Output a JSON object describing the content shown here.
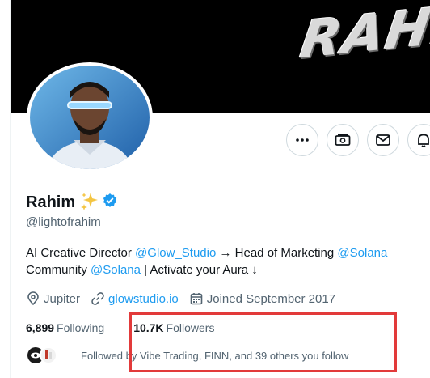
{
  "banner": {
    "text": "RAHI"
  },
  "profile": {
    "name": "Rahim",
    "name_emoji": "✨",
    "handle": "@lightofrahim",
    "bio": {
      "line1_text1": "AI Creative Director ",
      "line1_mention1": "@Glow_Studio",
      "line1_text2": " → Head of Marketing ",
      "line1_mention2": "@Solana",
      "line2_text1": "Community ",
      "line2_mention1": "@Solana",
      "line2_text2": " | Activate your Aura ↓"
    },
    "location": "Jupiter",
    "website": "glowstudio.io",
    "joined": "Joined September 2017",
    "following_count": "6,899",
    "following_label": "Following",
    "followers_count": "10.7K",
    "followers_label": "Followers",
    "followed_by": "Followed by Vibe Trading, FINN, and 39 others you follow"
  },
  "actions": {
    "more_icon": "more-icon",
    "subscribe_icon": "money-icon",
    "message_icon": "mail-icon",
    "notify_icon": "bell-plus-icon"
  },
  "colors": {
    "accent": "#1d9bf0",
    "verified": "#1d9bf0",
    "highlight": "#e23a3a",
    "banner": "#000000"
  }
}
